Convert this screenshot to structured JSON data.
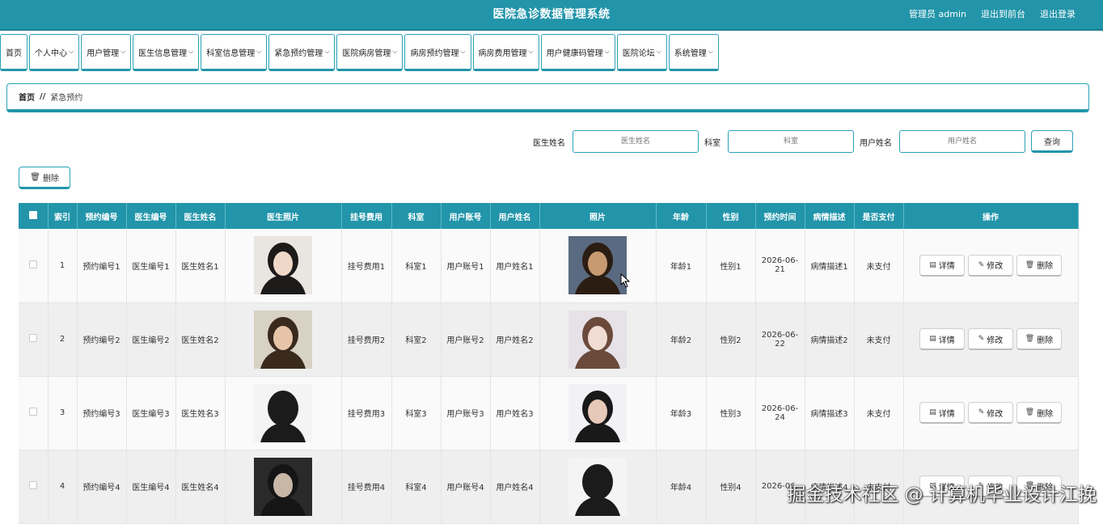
{
  "header": {
    "title": "医院急诊数据管理系统",
    "admin": "管理员 admin",
    "to_front": "退出到前台",
    "logout": "退出登录"
  },
  "menu": [
    {
      "label": "首页",
      "dropdown": false
    },
    {
      "label": "个人中心",
      "dropdown": true
    },
    {
      "label": "用户管理",
      "dropdown": true
    },
    {
      "label": "医生信息管理",
      "dropdown": true
    },
    {
      "label": "科室信息管理",
      "dropdown": true
    },
    {
      "label": "紧急预约管理",
      "dropdown": true
    },
    {
      "label": "医院病房管理",
      "dropdown": true
    },
    {
      "label": "病房预约管理",
      "dropdown": true
    },
    {
      "label": "病房费用管理",
      "dropdown": true
    },
    {
      "label": "用户健康码管理",
      "dropdown": true
    },
    {
      "label": "医院论坛",
      "dropdown": true
    },
    {
      "label": "系统管理",
      "dropdown": true
    }
  ],
  "breadcrumb": {
    "home": "首页",
    "sep": "//",
    "current": "紧急预约"
  },
  "search": {
    "doctor_label": "医生姓名",
    "doctor_placeholder": "医生姓名",
    "dept_label": "科室",
    "dept_placeholder": "科室",
    "user_label": "用户姓名",
    "user_placeholder": "用户姓名",
    "query_label": "查询"
  },
  "toolbar": {
    "delete_label": "删除",
    "delete_icon": "trash-icon"
  },
  "table": {
    "columns": [
      "索引",
      "预约编号",
      "医生编号",
      "医生姓名",
      "医生照片",
      "挂号费用",
      "科室",
      "用户账号",
      "用户姓名",
      "照片",
      "年龄",
      "性别",
      "预约时间",
      "病情描述",
      "是否支付",
      "操作"
    ],
    "actions": {
      "detail": "详情",
      "edit": "修改",
      "delete": "删除"
    },
    "rows": [
      {
        "index": "1",
        "appt_no": "预约编号1",
        "doc_no": "医生编号1",
        "doc_name": "医生姓名1",
        "fee": "挂号费用1",
        "dept": "科室1",
        "user_acct": "用户账号1",
        "user_name": "用户姓名1",
        "age": "年龄1",
        "gender": "性别1",
        "time": "2026-06-21",
        "desc": "病情描述1",
        "paid": "未支付"
      },
      {
        "index": "2",
        "appt_no": "预约编号2",
        "doc_no": "医生编号2",
        "doc_name": "医生姓名2",
        "fee": "挂号费用2",
        "dept": "科室2",
        "user_acct": "用户账号2",
        "user_name": "用户姓名2",
        "age": "年龄2",
        "gender": "性别2",
        "time": "2026-06-22",
        "desc": "病情描述2",
        "paid": "未支付"
      },
      {
        "index": "3",
        "appt_no": "预约编号3",
        "doc_no": "医生编号3",
        "doc_name": "医生姓名3",
        "fee": "挂号费用3",
        "dept": "科室3",
        "user_acct": "用户账号3",
        "user_name": "用户姓名3",
        "age": "年龄3",
        "gender": "性别3",
        "time": "2026-06-24",
        "desc": "病情描述3",
        "paid": "未支付"
      },
      {
        "index": "4",
        "appt_no": "预约编号4",
        "doc_no": "医生编号4",
        "doc_name": "医生姓名4",
        "fee": "挂号费用4",
        "dept": "科室4",
        "user_acct": "用户账号4",
        "user_name": "用户姓名4",
        "age": "年龄4",
        "gender": "性别4",
        "time": "2026-06-",
        "desc": "病情描述4",
        "paid": "未支付"
      }
    ]
  },
  "watermark": "掘金技术社区 @ 计算机毕业设计江挽",
  "colors": {
    "primary": "#2295aa",
    "border": "#2aa1b8"
  }
}
